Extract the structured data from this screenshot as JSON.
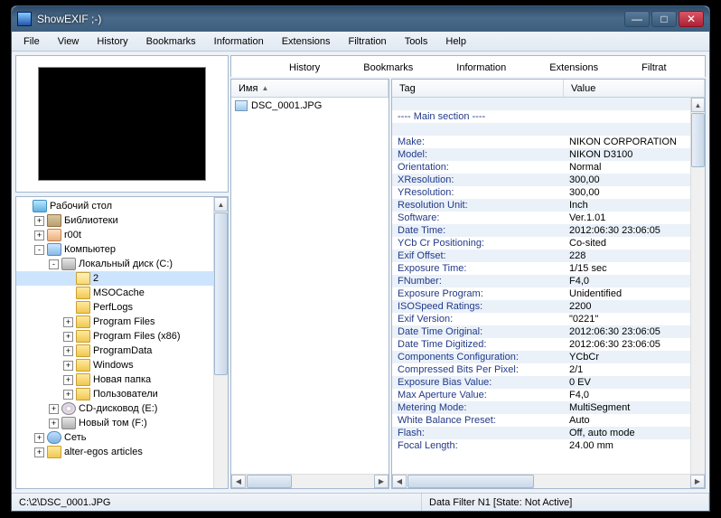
{
  "window": {
    "title": "ShowEXIF ;-)"
  },
  "menubar": [
    "File",
    "View",
    "History",
    "Bookmarks",
    "Information",
    "Extensions",
    "Filtration",
    "Tools",
    "Help"
  ],
  "tabs": [
    "History",
    "Bookmarks",
    "Information",
    "Extensions",
    "Filtration"
  ],
  "tree": [
    {
      "label": "Рабочий стол",
      "depth": 0,
      "exp": "",
      "icon": "ico-desktop"
    },
    {
      "label": "Библиотеки",
      "depth": 1,
      "exp": "+",
      "icon": "ico-lib"
    },
    {
      "label": "r00t",
      "depth": 1,
      "exp": "+",
      "icon": "ico-user"
    },
    {
      "label": "Компьютер",
      "depth": 1,
      "exp": "-",
      "icon": "ico-computer"
    },
    {
      "label": "Локальный диск (C:)",
      "depth": 2,
      "exp": "-",
      "icon": "ico-disk"
    },
    {
      "label": "2",
      "depth": 3,
      "exp": "",
      "icon": "ico-folder-open",
      "selected": true
    },
    {
      "label": "MSOCache",
      "depth": 3,
      "exp": "",
      "icon": "ico-folder"
    },
    {
      "label": "PerfLogs",
      "depth": 3,
      "exp": "",
      "icon": "ico-folder"
    },
    {
      "label": "Program Files",
      "depth": 3,
      "exp": "+",
      "icon": "ico-folder"
    },
    {
      "label": "Program Files (x86)",
      "depth": 3,
      "exp": "+",
      "icon": "ico-folder"
    },
    {
      "label": "ProgramData",
      "depth": 3,
      "exp": "+",
      "icon": "ico-folder"
    },
    {
      "label": "Windows",
      "depth": 3,
      "exp": "+",
      "icon": "ico-folder"
    },
    {
      "label": "Новая папка",
      "depth": 3,
      "exp": "+",
      "icon": "ico-folder"
    },
    {
      "label": "Пользователи",
      "depth": 3,
      "exp": "+",
      "icon": "ico-folder"
    },
    {
      "label": "CD-дисковод (E:)",
      "depth": 2,
      "exp": "+",
      "icon": "ico-cd"
    },
    {
      "label": "Новый том (F:)",
      "depth": 2,
      "exp": "+",
      "icon": "ico-disk"
    },
    {
      "label": "Сеть",
      "depth": 1,
      "exp": "+",
      "icon": "ico-net"
    },
    {
      "label": "alter-egos articles",
      "depth": 1,
      "exp": "+",
      "icon": "ico-folder"
    }
  ],
  "filelist": {
    "header": "Имя",
    "items": [
      "DSC_0001.JPG"
    ]
  },
  "exif": {
    "headers": {
      "tag": "Tag",
      "value": "Value"
    },
    "rows": [
      {
        "tag": "",
        "val": ""
      },
      {
        "tag": "---- Main section ----",
        "val": ""
      },
      {
        "tag": "",
        "val": ""
      },
      {
        "tag": "Make:",
        "val": "NIKON CORPORATION"
      },
      {
        "tag": "Model:",
        "val": "NIKON D3100"
      },
      {
        "tag": "Orientation:",
        "val": "Normal"
      },
      {
        "tag": "XResolution:",
        "val": "300,00"
      },
      {
        "tag": "YResolution:",
        "val": "300,00"
      },
      {
        "tag": "Resolution Unit:",
        "val": "Inch"
      },
      {
        "tag": "Software:",
        "val": "Ver.1.01"
      },
      {
        "tag": "Date Time:",
        "val": "2012:06:30 23:06:05"
      },
      {
        "tag": "YCb Cr Positioning:",
        "val": "Co-sited"
      },
      {
        "tag": "Exif Offset:",
        "val": "228"
      },
      {
        "tag": "Exposure Time:",
        "val": "1/15 sec"
      },
      {
        "tag": "FNumber:",
        "val": "F4,0"
      },
      {
        "tag": "Exposure Program:",
        "val": "Unidentified"
      },
      {
        "tag": "ISOSpeed Ratings:",
        "val": "2200"
      },
      {
        "tag": "Exif Version:",
        "val": "\"0221\""
      },
      {
        "tag": "Date Time Original:",
        "val": "2012:06:30 23:06:05"
      },
      {
        "tag": "Date Time Digitized:",
        "val": "2012:06:30 23:06:05"
      },
      {
        "tag": "Components Configuration:",
        "val": "YCbCr"
      },
      {
        "tag": "Compressed Bits Per Pixel:",
        "val": "2/1"
      },
      {
        "tag": "Exposure Bias Value:",
        "val": "0 EV"
      },
      {
        "tag": "Max Aperture Value:",
        "val": "F4,0"
      },
      {
        "tag": "Metering Mode:",
        "val": "MultiSegment"
      },
      {
        "tag": "White Balance Preset:",
        "val": "Auto"
      },
      {
        "tag": "Flash:",
        "val": "Off, auto mode"
      },
      {
        "tag": "Focal Length:",
        "val": "24.00 mm"
      }
    ]
  },
  "statusbar": {
    "path": "C:\\2\\DSC_0001.JPG",
    "filter": "Data Filter N1 [State: Not Active]"
  }
}
